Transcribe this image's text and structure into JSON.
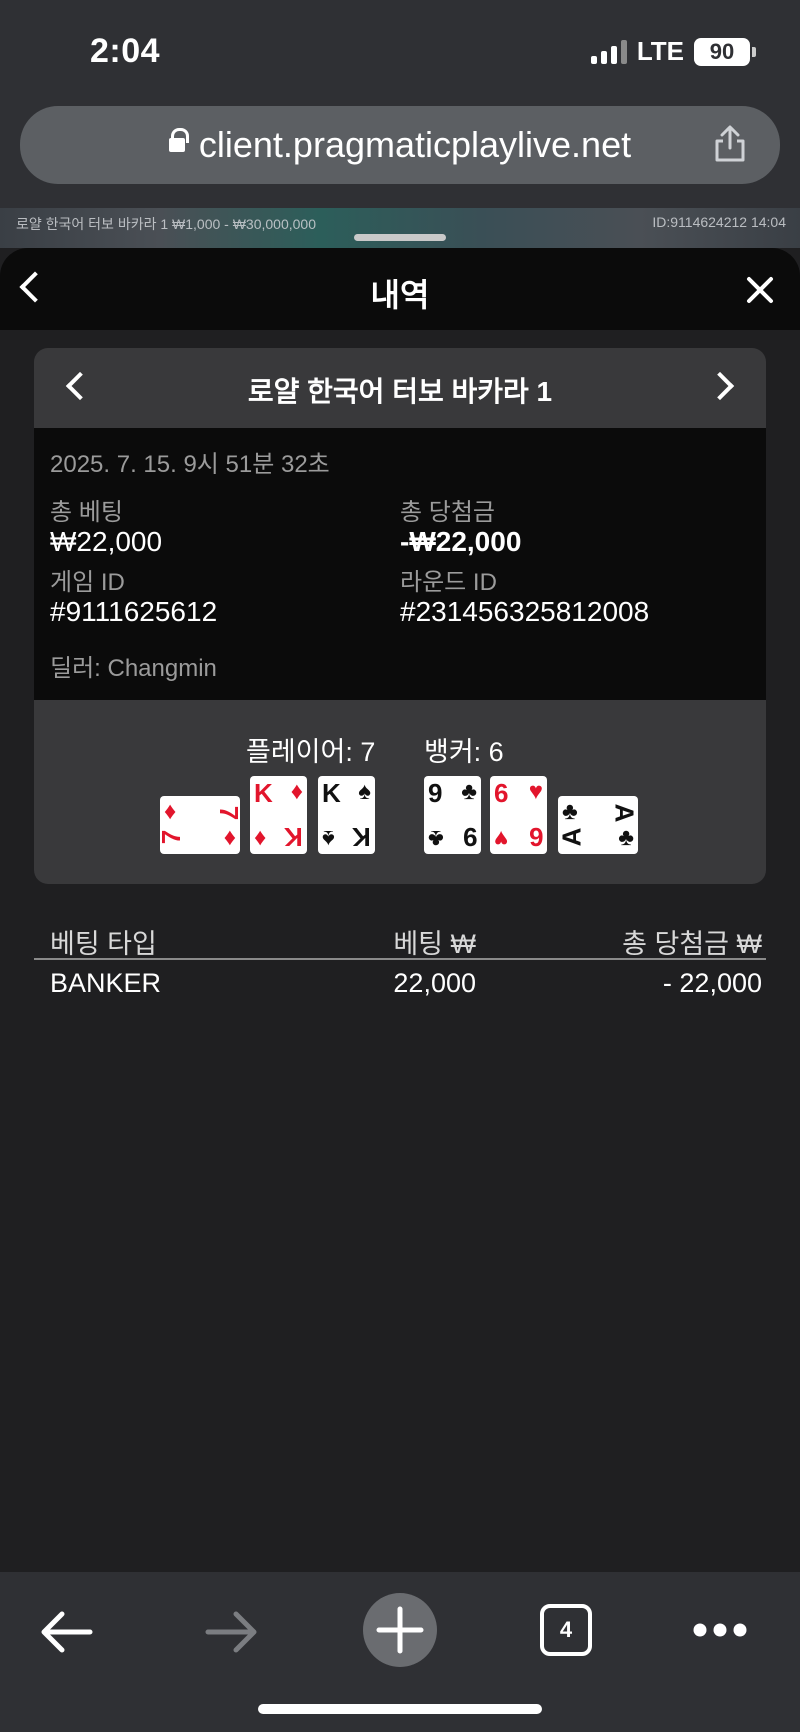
{
  "status_bar": {
    "time": "2:04",
    "network": "LTE",
    "battery": "90"
  },
  "browser": {
    "url": "client.pragmaticplaylive.net",
    "tab_count": "4"
  },
  "game_strip": {
    "left_text": "로얄 한국어 터보 바카라 1  ₩1,000 - ₩30,000,000",
    "right_text": "ID:9114624212  14:04"
  },
  "sheet": {
    "title": "내역"
  },
  "round": {
    "game_name": "로얄 한국어 터보 바카라 1",
    "datetime": "2025. 7. 15. 9시 51분 32초",
    "total_bet_label": "총 베팅",
    "total_bet_value": "₩22,000",
    "total_win_label": "총 당첨금",
    "total_win_value": "-₩22,000",
    "game_id_label": "게임 ID",
    "game_id_value": "#9111625612",
    "round_id_label": "라운드 ID",
    "round_id_value": "#231456325812008",
    "dealer": "딜러: Changmin"
  },
  "hands": {
    "player_label": "플레이어: 7",
    "banker_label": "뱅커: 6",
    "player_cards": [
      {
        "rank": "7",
        "suit": "♦",
        "color": "#e2152c",
        "orientation": "sideways"
      },
      {
        "rank": "K",
        "suit": "♦",
        "color": "#e2152c",
        "orientation": "upright"
      },
      {
        "rank": "K",
        "suit": "♠",
        "color": "#111111",
        "orientation": "upright"
      }
    ],
    "banker_cards": [
      {
        "rank": "9",
        "suit": "♣",
        "color": "#111111",
        "orientation": "upright"
      },
      {
        "rank": "6",
        "suit": "♥",
        "color": "#e2152c",
        "orientation": "upright"
      },
      {
        "rank": "A",
        "suit": "♣",
        "color": "#111111",
        "orientation": "sideways"
      }
    ]
  },
  "bets_table": {
    "headers": [
      "베팅 타입",
      "베팅 ₩",
      "총 당첨금 ₩"
    ],
    "rows": [
      {
        "type": "BANKER",
        "bet": "22,000",
        "win": "- 22,000"
      }
    ]
  }
}
